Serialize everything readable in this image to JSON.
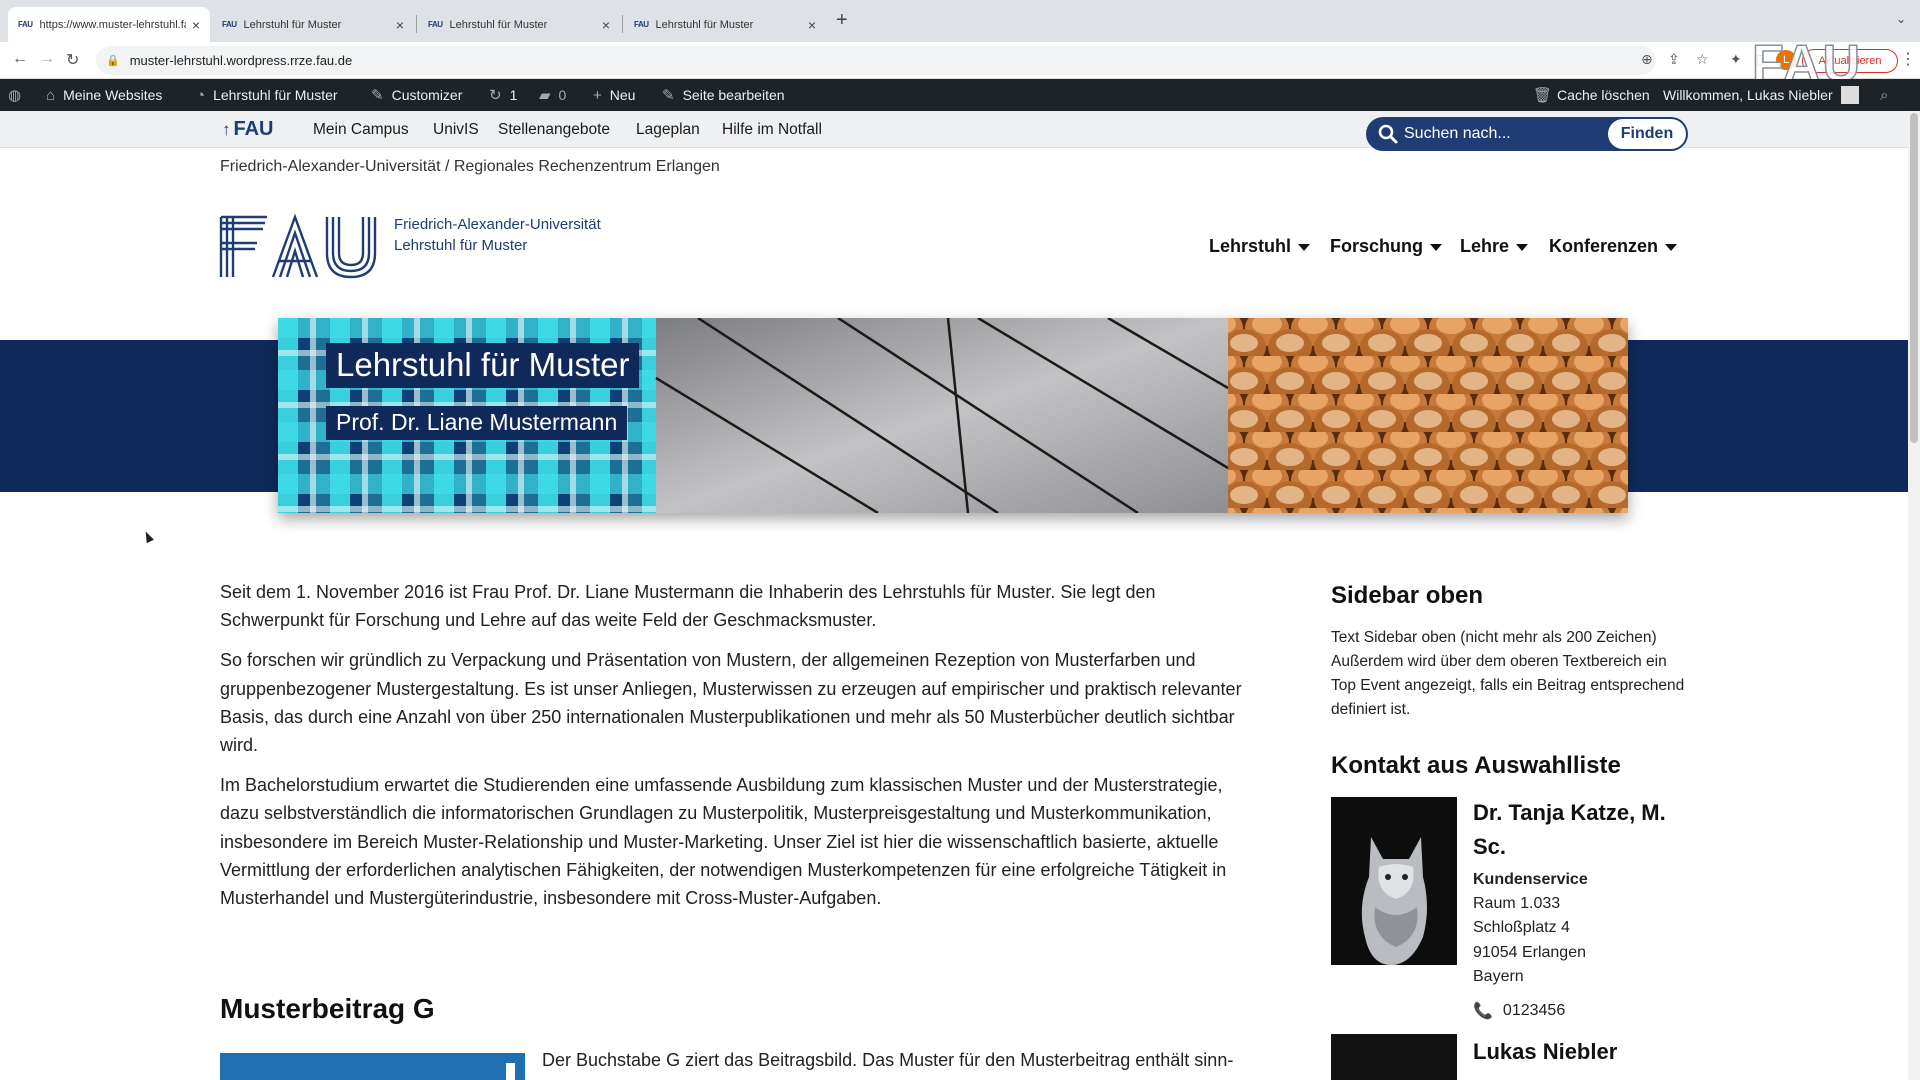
{
  "browser": {
    "tabs": [
      {
        "favicon": "FAU",
        "title": "https://www.muster-lehrstuhl.fau...",
        "active": true
      },
      {
        "favicon": "FAU",
        "title": "Lehrstuhl für Muster",
        "active": false
      },
      {
        "favicon": "FAU",
        "title": "Lehrstuhl für Muster",
        "active": false
      },
      {
        "favicon": "FAU",
        "title": "Lehrstuhl für Muster",
        "active": false
      }
    ],
    "url": "muster-lehrstuhl.wordpress.rrze.fau.de",
    "profile_initial": "L",
    "update_label": "Aktualisieren",
    "watermark": "FAU"
  },
  "wpbar": {
    "my_sites": "Meine Websites",
    "site_name": "Lehrstuhl für Muster",
    "customizer": "Customizer",
    "updates_count": "1",
    "comments_count": "0",
    "new_label": "Neu",
    "edit_page": "Seite bearbeiten",
    "clear_cache": "Cache löschen",
    "welcome": "Willkommen, Lukas Niebler"
  },
  "metanav": {
    "fau_label": "FAU",
    "links": [
      "Mein Campus",
      "UnivIS",
      "Stellenangebote",
      "Lageplan",
      "Hilfe im Notfall"
    ],
    "search_placeholder": "Suchen nach...",
    "search_button": "Finden"
  },
  "header": {
    "breadcrumb": "Friedrich-Alexander-Universität / Regionales Rechenzentrum Erlangen",
    "org_line1": "Friedrich-Alexander-Universität",
    "org_line2": "Lehrstuhl für Muster",
    "nav": [
      "Lehrstuhl",
      "Forschung",
      "Lehre",
      "Konferenzen"
    ]
  },
  "hero": {
    "title": "Lehrstuhl für Muster",
    "subtitle": "Prof. Dr. Liane Mustermann"
  },
  "content": {
    "paragraphs": [
      "Seit dem 1. November 2016 ist Frau Prof. Dr. Liane Mustermann die Inhaberin des Lehrstuhls für Muster. Sie legt den Schwerpunkt für Forschung und Lehre auf das weite Feld der Geschmacksmuster.",
      "So forschen wir gründlich zu Verpackung und Präsentation von Mustern, der allgemeinen Rezeption von Musterfarben und gruppenbezogener Mustergestaltung. Es ist unser Anliegen, Musterwissen zu erzeugen auf empirischer und praktisch relevanter Basis, das durch eine Anzahl von über 250 internationalen Musterpublikationen und mehr als 50 Musterbücher deutlich sichtbar wird.",
      "Im Bachelorstudium erwartet die Studierenden eine umfassende Ausbildung zum klassischen Muster und der Musterstrategie, dazu selbstverständlich die informatorischen Grundlagen zu Musterpolitik, Musterpreisgestaltung und Musterkommunikation, insbesondere im Bereich Muster-Relationship und Muster-Marketing. Unser Ziel ist hier die wissenschaftlich basierte, aktuelle Vermittlung der erforderlichen analytischen Fähigkeiten, der notwendigen Musterkompetenzen für eine erfolgreiche Tätigkeit in Musterhandel und Mustergüterindustrie, insbesondere mit Cross-Muster-Aufgaben."
    ],
    "post_title": "Musterbeitrag G",
    "post_excerpt": "Der Buchstabe G ziert das Beitragsbild. Das Muster für den Musterbeitrag enthält sinn-"
  },
  "sidebar": {
    "heading_top": "Sidebar oben",
    "text_top": "Text Sidebar oben (nicht mehr als 200 Zeichen) Außerdem wird über dem oberen Textbereich ein Top Event angezeigt, falls ein Beitrag entsprechend definiert ist.",
    "heading_contact": "Kontakt aus Auswahlliste",
    "contacts": [
      {
        "name": "Dr. Tanja Katze, M. Sc.",
        "department": "Kundenservice",
        "room": "Raum 1.033",
        "street": "Schloßplatz 4",
        "city": "91054 Erlangen",
        "region": "Bayern",
        "phone": "0123456"
      },
      {
        "name": "Lukas Niebler"
      }
    ]
  },
  "colors": {
    "fau_blue": "#1f3c75",
    "hero_band": "#0f2a5a",
    "wp_admin_bar": "#1d2327"
  }
}
